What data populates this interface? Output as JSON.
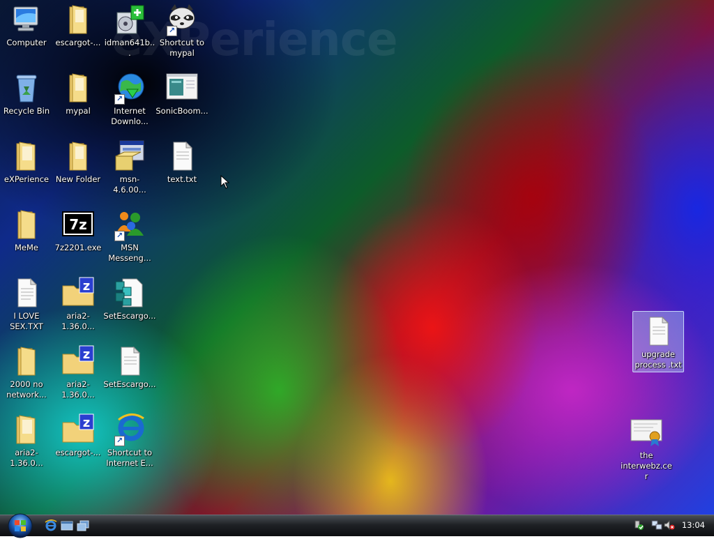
{
  "wallpaper": {
    "watermark": "eXPerience"
  },
  "icons": [
    {
      "id": "computer",
      "label": "Computer"
    },
    {
      "id": "escargot-folder-1",
      "label": "escargot-..."
    },
    {
      "id": "idman-installer",
      "label": "idman641b..."
    },
    {
      "id": "shortcut-mypal",
      "label": "Shortcut to mypal"
    },
    {
      "id": "recycle-bin",
      "label": "Recycle Bin"
    },
    {
      "id": "mypal-folder",
      "label": "mypal"
    },
    {
      "id": "internet-download-manager",
      "label": "Internet Downlo..."
    },
    {
      "id": "sonicboom",
      "label": "SonicBoom..."
    },
    {
      "id": "experience-folder",
      "label": "eXPerience"
    },
    {
      "id": "new-folder",
      "label": "New Folder"
    },
    {
      "id": "msn-installer",
      "label": "msn-4.6.00..."
    },
    {
      "id": "text-txt",
      "label": "text.txt"
    },
    {
      "id": "meme-folder",
      "label": "MeMe"
    },
    {
      "id": "7z-exe",
      "label": "7z2201.exe"
    },
    {
      "id": "msn-messenger",
      "label": "MSN Messeng..."
    },
    {
      "id": "i-love-sex-txt",
      "label": "I LOVE SEX.TXT"
    },
    {
      "id": "aria2-zip-1",
      "label": "aria2-1.36.0..."
    },
    {
      "id": "setescargot-1",
      "label": "SetEscargo..."
    },
    {
      "id": "2000-no-network",
      "label": "2000 no network..."
    },
    {
      "id": "aria2-zip-2",
      "label": "aria2-1.36.0..."
    },
    {
      "id": "setescargot-2",
      "label": "SetEscargo..."
    },
    {
      "id": "aria2-folder",
      "label": "aria2-1.36.0..."
    },
    {
      "id": "escargot-zip",
      "label": "escargot-..."
    },
    {
      "id": "shortcut-ie",
      "label": "Shortcut to Internet E..."
    },
    {
      "id": "upgrade-process-txt",
      "label": "upgrade process .txt"
    },
    {
      "id": "the-interwebz-cer",
      "label": "the interwebz.cer"
    }
  ],
  "taskbar": {
    "clock": "13:04"
  },
  "colors": {
    "folder": "#f3d57a",
    "taskbar": "#1f2226",
    "selection": "#aac8f0"
  }
}
